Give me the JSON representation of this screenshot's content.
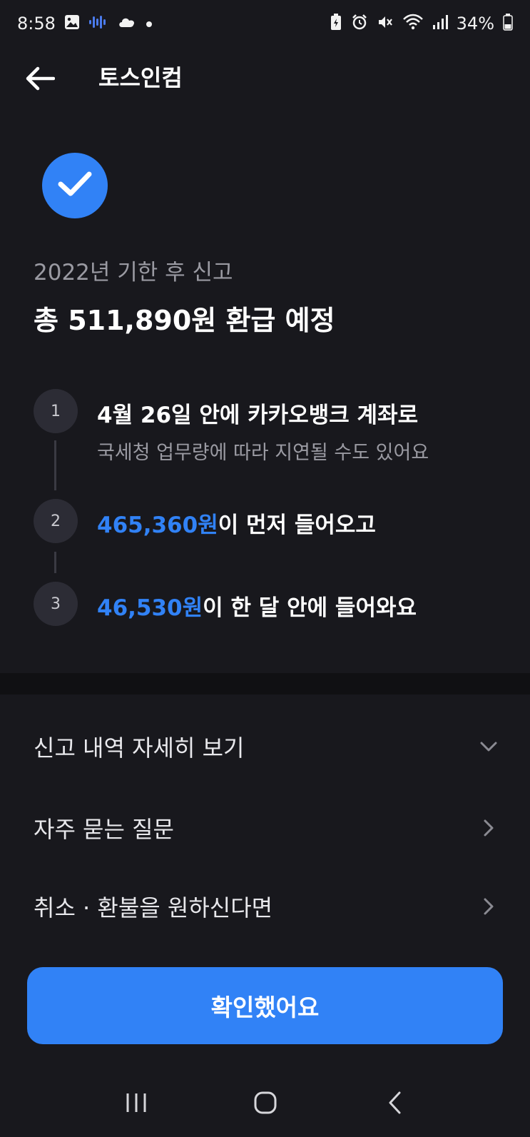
{
  "status_bar": {
    "time": "8:58",
    "battery_percent": "34%",
    "left_icons": [
      "gallery-icon",
      "voice-recorder-icon",
      "cloud-icon",
      "dot-icon"
    ],
    "right_icons": [
      "battery-saver-icon",
      "alarm-icon",
      "mute-icon",
      "wifi-icon",
      "signal-icon",
      "battery-icon"
    ]
  },
  "header": {
    "title": "토스인컴"
  },
  "summary": {
    "subtitle": "2022년 기한 후 신고",
    "title": "총 511,890원 환급 예정"
  },
  "steps": [
    {
      "number": "1",
      "text": "4월 26일 안에 카카오뱅크 계좌로",
      "sub": "국세청 업무량에 따라 지연될 수도 있어요"
    },
    {
      "number": "2",
      "amount": "465,360원",
      "rest": "이 먼저 들어오고"
    },
    {
      "number": "3",
      "amount": "46,530원",
      "rest": "이 한 달 안에 들어와요"
    }
  ],
  "menu": [
    {
      "label": "신고 내역 자세히 보기",
      "icon": "chevron-down-icon"
    },
    {
      "label": "자주 묻는 질문",
      "icon": "chevron-right-icon"
    },
    {
      "label": "취소 · 환불을 원하신다면",
      "icon": "chevron-right-icon"
    }
  ],
  "confirm_button": {
    "label": "확인했어요"
  },
  "colors": {
    "background": "#18181d",
    "accent": "#3182f6",
    "muted_text": "#9a9aa2"
  }
}
